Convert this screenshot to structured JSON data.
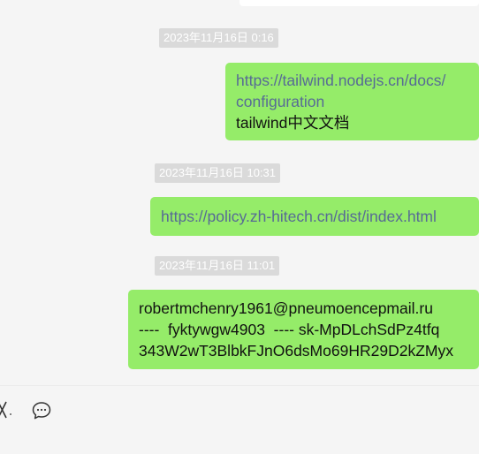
{
  "messages": [
    {
      "timestamp": "2023年11月16日 0:16",
      "link_line1": "https://tailwind.nodejs.cn/docs/",
      "link_line2": "configuration",
      "text": "tailwind中文文档"
    },
    {
      "timestamp": "2023年11月16日 10:31",
      "link": "https://policy.zh-hitech.cn/dist/index.html"
    },
    {
      "timestamp": "2023年11月16日 11:01",
      "line1": "robertmchenry1961@pneumoencepmail.ru",
      "line2": "----  fyktywgw4903  ---- sk-MpDLchSdPz4tfq",
      "line3": "343W2wT3BlbkFJnO6dsMo69HR29D2kZMyx"
    }
  ],
  "toolbar": {
    "icons": [
      "scissors-icon",
      "chat-bubble-icon"
    ]
  },
  "colors": {
    "bubble_self": "#95ec69",
    "link": "#576b95",
    "timestamp_bg": "#dadada",
    "background": "#f5f5f5"
  }
}
